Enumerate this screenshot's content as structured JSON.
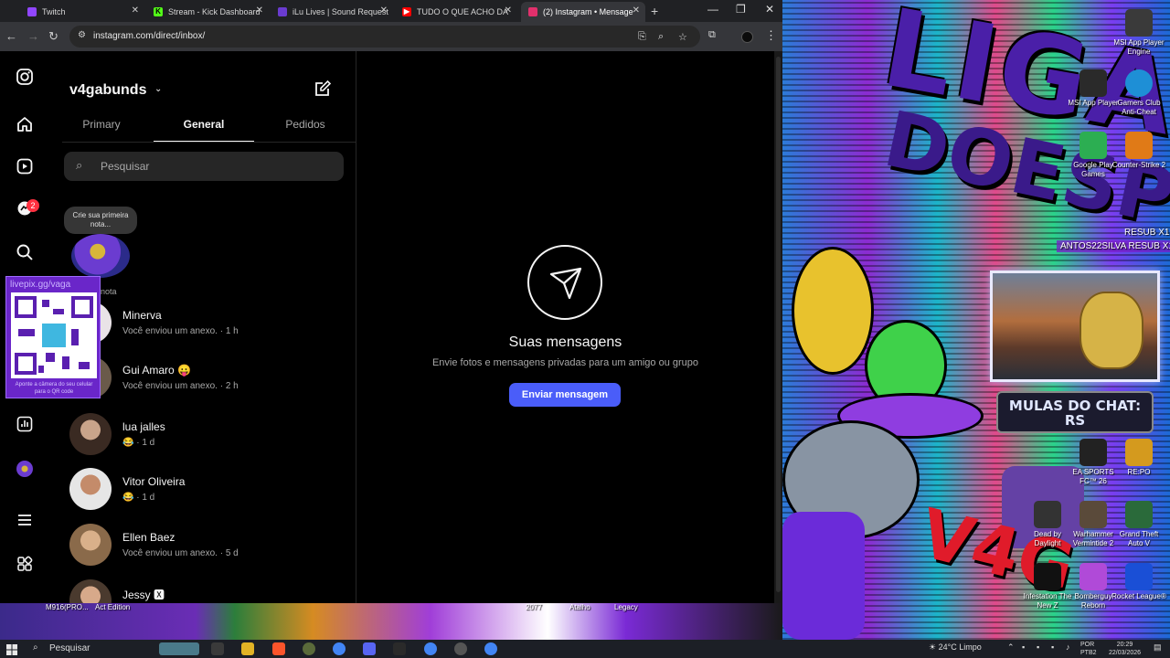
{
  "browser": {
    "tabs": [
      {
        "label": "Twitch",
        "color": "#9146ff"
      },
      {
        "label": "Stream - Kick Dashboard",
        "color": "#53fc18"
      },
      {
        "label": "iLu Lives | Sound Request",
        "color": "#6a3bd0"
      },
      {
        "label": "TUDO O QUE ACHO DA",
        "color": "#ff0000"
      },
      {
        "label": "(2) Instagram • Mensage",
        "color": "#e1306c"
      }
    ],
    "url": "instagram.com/direct/inbox/"
  },
  "instagram": {
    "account": "v4gabunds",
    "tabs": [
      "Primary",
      "General",
      "Pedidos"
    ],
    "active_tab": "General",
    "search_placeholder": "Pesquisar",
    "notification_count": "2",
    "note": {
      "bubble": "Crie sua primeira nota...",
      "label": "nota"
    },
    "conversations": [
      {
        "name": "Minerva",
        "preview": "Você enviou um anexo. · 1 h"
      },
      {
        "name": "Gui Amaro 😛",
        "preview": "Você enviou um anexo. · 2 h"
      },
      {
        "name": "lua jalles",
        "preview": "😂 · 1 d"
      },
      {
        "name": "Vitor Oliveira",
        "preview": "😂 · 1 d"
      },
      {
        "name": "Ellen Baez",
        "preview": "Você enviou um anexo. · 5 d"
      },
      {
        "name": "Jessy 🆇",
        "preview": ""
      }
    ],
    "empty_state": {
      "title": "Suas mensagens",
      "subtitle": "Envie fotos e mensagens privadas para um amigo ou grupo",
      "button": "Enviar mensagem"
    },
    "qr_overlay": {
      "title": "livepix.gg/vaga",
      "footer": "Aponte a câmera do seu celular para o QR code"
    }
  },
  "desktop": {
    "icons": [
      {
        "label": "MSI App Player Engine"
      },
      {
        "label": "MSI App Player"
      },
      {
        "label": "Gamers Club Anti-Cheat"
      },
      {
        "label": "Google Play Games"
      },
      {
        "label": "Counter-Strike 2"
      },
      {
        "label": "EA SPORTS FC™ 26"
      },
      {
        "label": "RE:PO"
      },
      {
        "label": "Dead by Daylight"
      },
      {
        "label": "Warhammer Vermintide 2"
      },
      {
        "label": "Grand Theft Auto V"
      },
      {
        "label": "Infestation The New Z"
      },
      {
        "label": "Bomberguy Reborn"
      },
      {
        "label": "Rocket League®"
      }
    ],
    "overlay_texts": [
      "ANTOS22SILVA  RESUB X18",
      "RESUB X17"
    ],
    "overlay_banner": "MULAS DO CHAT: RS"
  },
  "stream_strip": {
    "labels": [
      "M916(PRO...",
      "Act Edition",
      "2077",
      "Atalho",
      "Legacy"
    ]
  },
  "taskbar": {
    "search": "Pesquisar",
    "weather": "24°C  Limpo",
    "lang": [
      "POR",
      "PTB2"
    ],
    "time": "20:29",
    "date": "22/03/2026"
  }
}
